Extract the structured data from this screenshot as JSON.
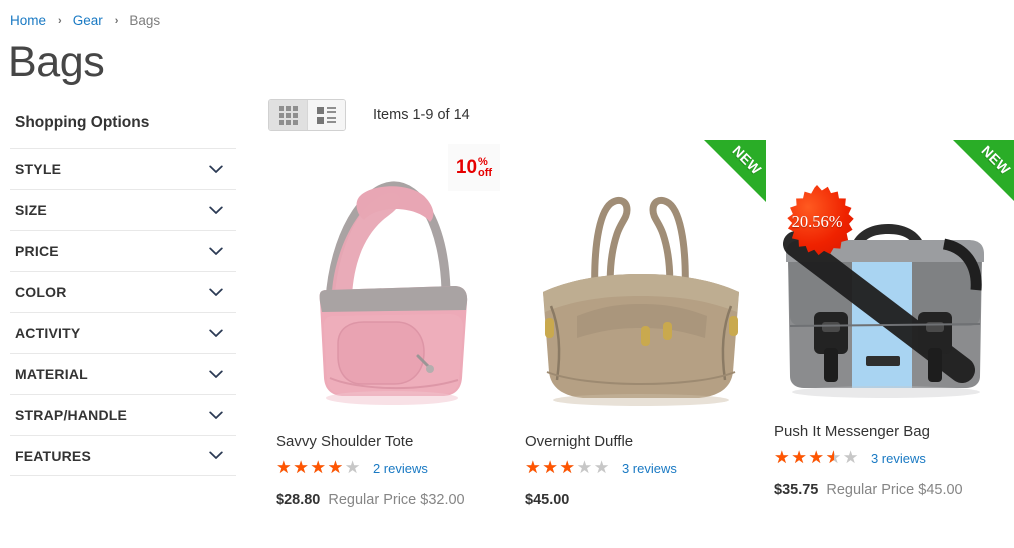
{
  "breadcrumb": {
    "items": [
      {
        "label": "Home",
        "type": "link"
      },
      {
        "label": "Gear",
        "type": "link"
      },
      {
        "label": "Bags",
        "type": "current"
      }
    ],
    "separator": "›"
  },
  "page_title": "Bags",
  "sidebar": {
    "title": "Shopping Options",
    "filters": [
      {
        "label": "STYLE",
        "icon": "chevron-down-icon"
      },
      {
        "label": "SIZE",
        "icon": "chevron-down-icon"
      },
      {
        "label": "PRICE",
        "icon": "chevron-down-icon"
      },
      {
        "label": "COLOR",
        "icon": "chevron-down-icon"
      },
      {
        "label": "ACTIVITY",
        "icon": "chevron-down-icon"
      },
      {
        "label": "MATERIAL",
        "icon": "chevron-down-icon"
      },
      {
        "label": "STRAP/HANDLE",
        "icon": "chevron-down-icon"
      },
      {
        "label": "FEATURES",
        "icon": "chevron-down-icon"
      }
    ]
  },
  "toolbar": {
    "grid_view_icon": "grid-view-icon",
    "list_view_icon": "list-view-icon",
    "active_view": "list",
    "amount_text": "Items 1-9 of 14"
  },
  "products": [
    {
      "name": "Savvy Shoulder Tote",
      "rating_percent": 80,
      "stars_display": "★★★★★",
      "reviews_text": "2 reviews",
      "price_special": "$28.80",
      "price_regular_label": "Regular Price",
      "price_regular": "$32.00",
      "badge_type": "percent-flat",
      "badge_number": "10",
      "badge_percent_symbol": "%",
      "badge_off_text": "off",
      "ribbon": null,
      "image_alt": "pink-shoulder-tote-bag"
    },
    {
      "name": "Overnight Duffle",
      "rating_percent": 60,
      "stars_display": "★★★★★",
      "reviews_text": "3 reviews",
      "price_special": "$45.00",
      "price_regular_label": "",
      "price_regular": "",
      "badge_type": null,
      "badge_number": "",
      "badge_percent_symbol": "",
      "badge_off_text": "",
      "ribbon": "NEW",
      "image_alt": "tan-overnight-duffle-bag"
    },
    {
      "name": "Push It Messenger Bag",
      "rating_percent": 70,
      "stars_display": "★★★★★",
      "reviews_text": "3 reviews",
      "price_special": "$35.75",
      "price_regular_label": "Regular Price",
      "price_regular": "$45.00",
      "badge_type": "starburst",
      "badge_number": "20.56%",
      "badge_percent_symbol": "",
      "badge_off_text": "",
      "ribbon": "NEW",
      "image_alt": "gray-blue-messenger-bag"
    }
  ],
  "colors": {
    "link": "#1979c3",
    "star_filled": "#ff5501",
    "star_empty": "#c7c7c7",
    "ribbon_green": "#2aad27",
    "badge_red": "#e60000",
    "starburst_red": "#ef2200"
  }
}
